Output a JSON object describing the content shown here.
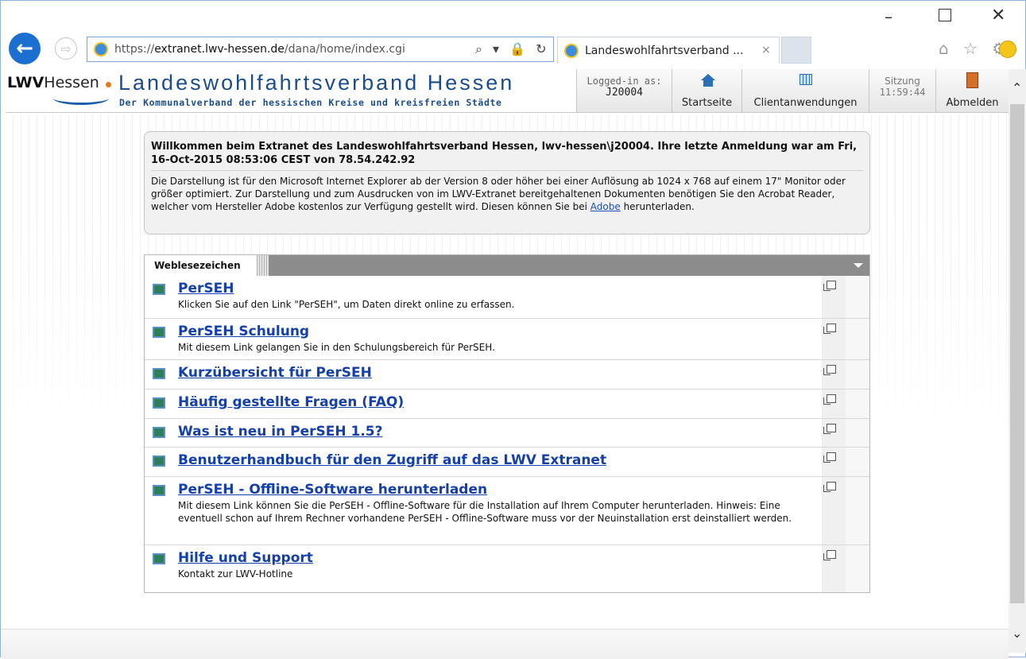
{
  "browser": {
    "url_prefix": "https://",
    "url_host": "extranet.lwv-hessen.de",
    "url_path": "/dana/home/index.cgi",
    "tab_title": "Landeswohlfahrtsverband ...",
    "tab_close": "×",
    "address_icons": "⌕ ▾ 🔒 ↻",
    "minimize": "–",
    "close": "✕",
    "back": "←",
    "forward": "⇨",
    "toolbar_icons": "⌂ ☆ ⚙",
    "scroll_up": "⌃",
    "scroll_down": "⌄"
  },
  "header": {
    "logo_prefix": "LWV",
    "logo_suffix": "Hessen",
    "org_title": "Landeswohlfahrtsverband Hessen",
    "org_subtitle": "Der Kommunalverband der hessischen Kreise und kreisfreien Städte",
    "logged_in_label": "Logged-in as:",
    "user_id": "J20004",
    "startseite": "Startseite",
    "clientanwendungen": "Clientanwendungen",
    "session_label": "Sitzung",
    "session_time": "11:59:44",
    "logout": "Abmelden"
  },
  "welcome": {
    "title": "Willkommen beim Extranet des Landeswohlfahrtsverband Hessen, lwv-hessen\\j20004.  Ihre letzte Anmeldung war am  Fri, 16-Oct-2015 08:53:06 CEST  von  78.54.242.92",
    "text_before_link": "Die Darstellung ist für den Microsoft Internet Explorer ab der Version 8 oder höher bei einer Auflösung ab 1024 x 768 auf einem 17\" Monitor oder größer optimiert. Zur Darstellung und zum Ausdrucken von im LWV-Extranet bereitgehaltenen Dokumenten benötigen Sie den Acrobat Reader, welcher vom Hersteller Adobe kostenlos zur Verfügung gestellt wird. Diesen können Sie bei ",
    "link_text": "Adobe",
    "text_after_link": " herunterladen."
  },
  "bookmarks": {
    "tab_label": "Weblesezeichen",
    "items": [
      {
        "title": "PerSEH",
        "desc": "Klicken Sie auf den Link \"PerSEH\", um Daten direkt online zu erfassen."
      },
      {
        "title": "PerSEH Schulung",
        "desc": "Mit diesem Link gelangen Sie in den Schulungsbereich für PerSEH."
      },
      {
        "title": "Kurzübersicht für PerSEH",
        "desc": ""
      },
      {
        "title": "Häufig gestellte Fragen (FAQ)",
        "desc": ""
      },
      {
        "title": "Was ist neu in PerSEH 1.5?",
        "desc": ""
      },
      {
        "title": "Benutzerhandbuch für den Zugriff auf das LWV Extranet",
        "desc": ""
      },
      {
        "title": "PerSEH - Offline-Software herunterladen",
        "desc": "Mit diesem Link können Sie die PerSEH - Offline-Software für die Installation auf Ihrem Computer herunterladen. Hinweis: Eine eventuell schon auf Ihrem Rechner vorhandene PerSEH - Offline-Software muss vor der Neuinstallation erst deinstalliert werden."
      },
      {
        "title": "Hilfe und Support",
        "desc": "Kontakt zur LWV-Hotline"
      }
    ]
  },
  "colors": {
    "link": "#1440a8",
    "brand_blue": "#1a4d8c",
    "ie_blue": "#1a6fd0"
  }
}
